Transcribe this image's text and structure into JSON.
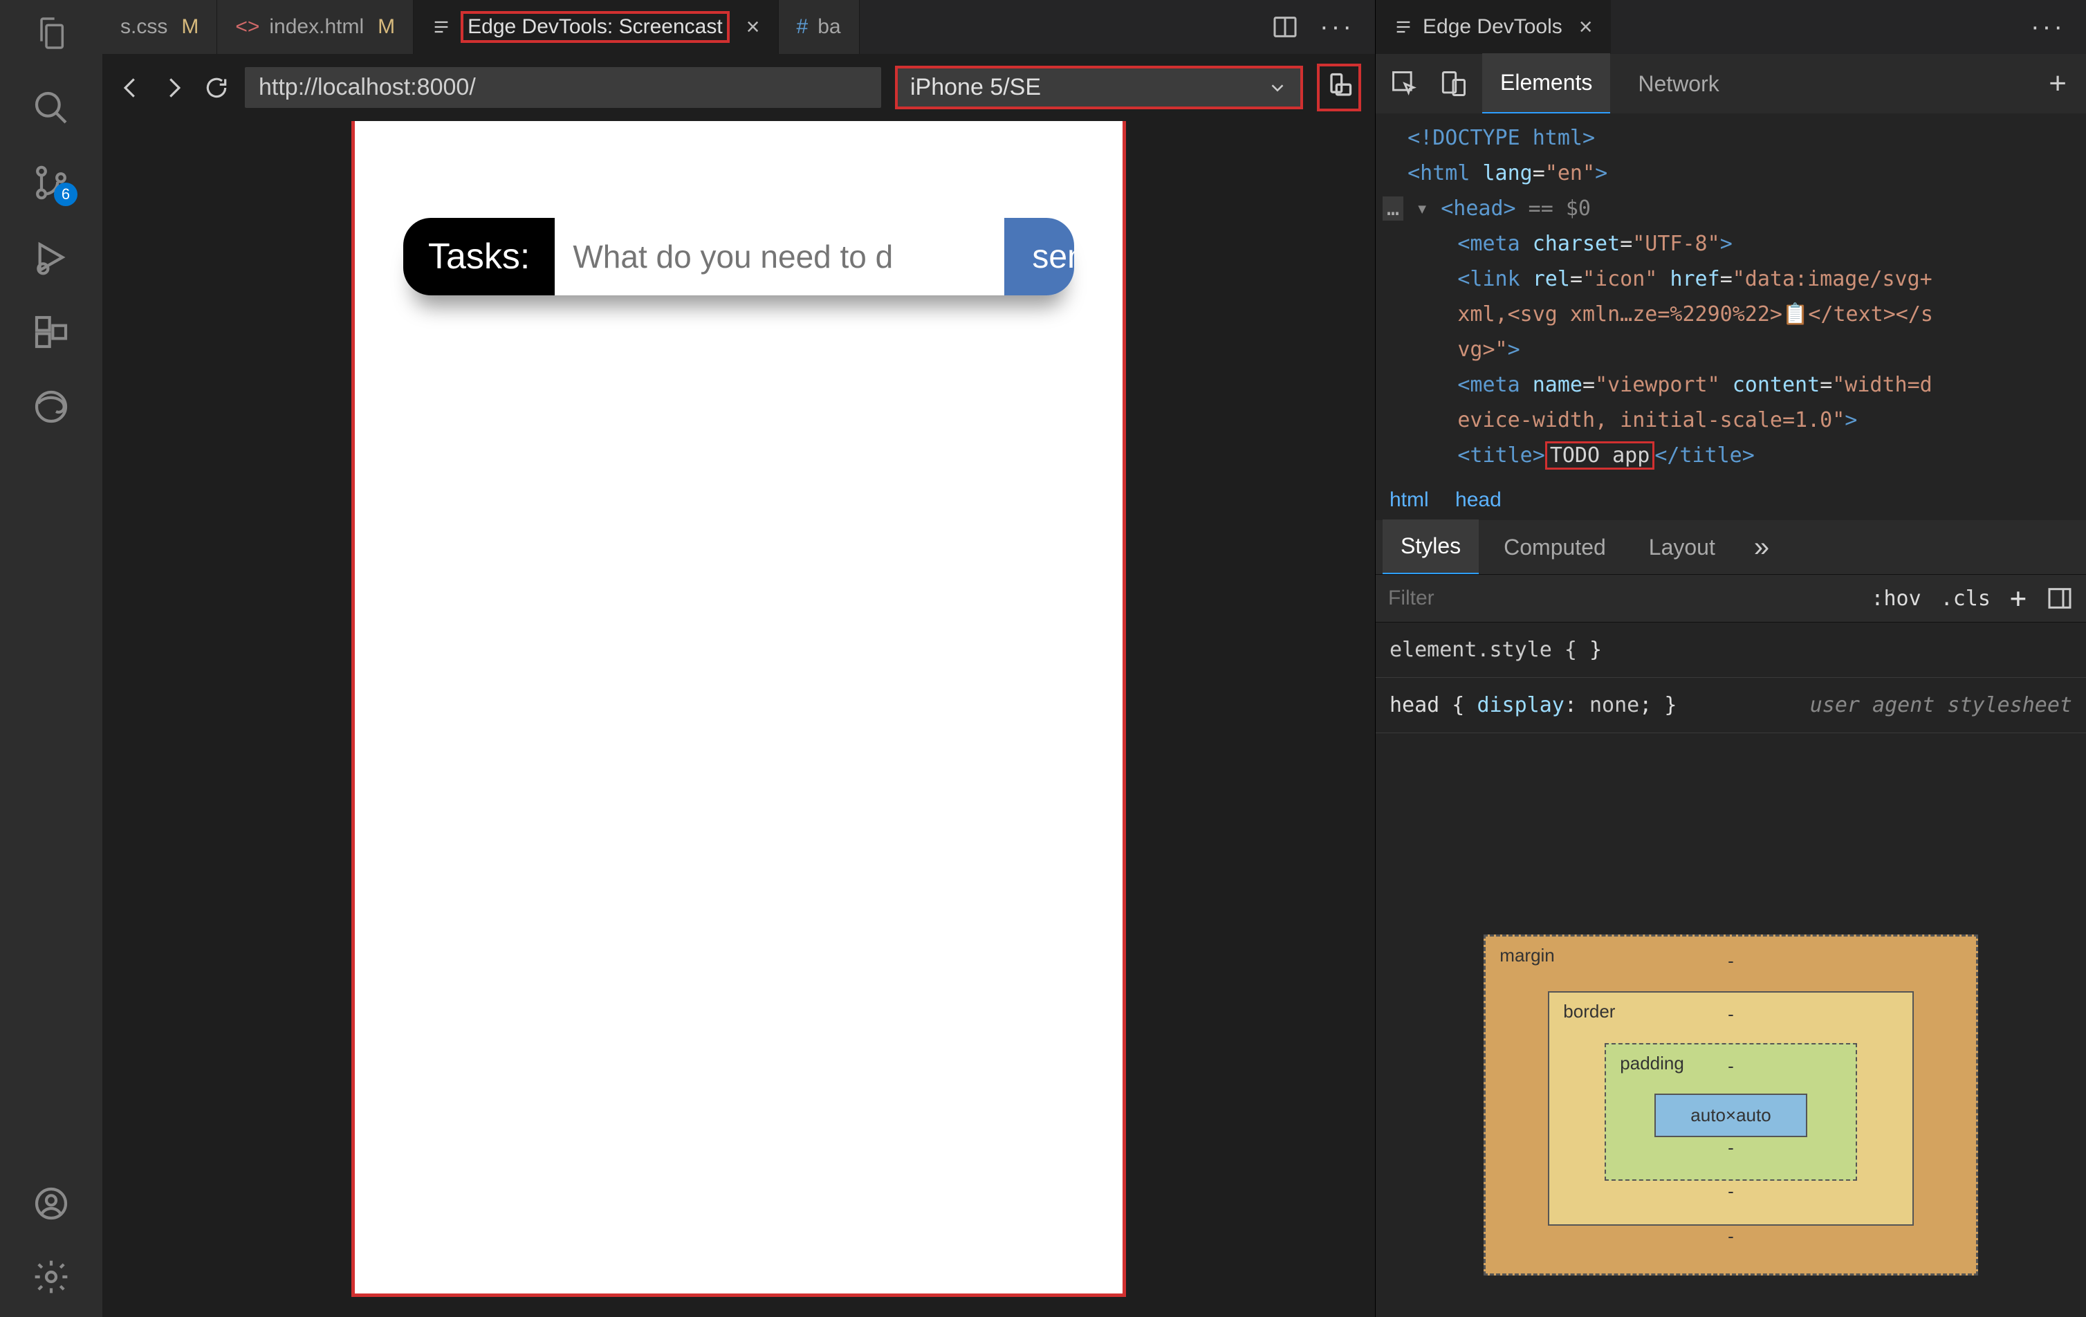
{
  "activity": {
    "scm_badge": "6"
  },
  "tabs": {
    "css": {
      "name": "s.css",
      "mod": "M"
    },
    "html": {
      "name": "index.html",
      "mod": "M"
    },
    "screencast": {
      "name": "Edge DevTools: Screencast"
    },
    "bas": {
      "name": "ba"
    }
  },
  "nav": {
    "url": "http://localhost:8000/",
    "device": "iPhone 5/SE"
  },
  "app": {
    "tasks_label": "Tasks:",
    "input_placeholder": "What do you need to d",
    "send": "send"
  },
  "devtools": {
    "panel_title": "Edge DevTools",
    "elements": "Elements",
    "network": "Network",
    "dom": {
      "doctype": "<!DOCTYPE html>",
      "html_open": "<html lang=\"en\">",
      "head_open": "<head>",
      "head_meta_dim": " == $0",
      "meta_charset": "<meta charset=\"UTF-8\">",
      "link_l1": "<link rel=\"icon\" href=\"data:image/svg+",
      "link_l2": "xml,<svg xmln…ze=%2290%22>📋</text></s",
      "link_l3": "vg>\">",
      "meta_vp_l1": "<meta name=\"viewport\" content=\"width=d",
      "meta_vp_l2": "evice-width, initial-scale=1.0\">",
      "title_open": "<title>",
      "title_text": "TODO app",
      "title_close": "</title>"
    },
    "breadcrumb": {
      "html": "html",
      "head": "head"
    },
    "styles_tab": "Styles",
    "computed_tab": "Computed",
    "layout_tab": "Layout",
    "filter_placeholder": "Filter",
    "hov": ":hov",
    "cls": ".cls",
    "element_style": "element.style {",
    "close_brace": "}",
    "head_rule_sel": "head {",
    "head_rule_prop": "display",
    "head_rule_val": "none",
    "ua_sheet": "user agent stylesheet",
    "boxmodel": {
      "margin": "margin",
      "border": "border",
      "padding": "padding",
      "content": "auto×auto",
      "dash": "-"
    }
  }
}
